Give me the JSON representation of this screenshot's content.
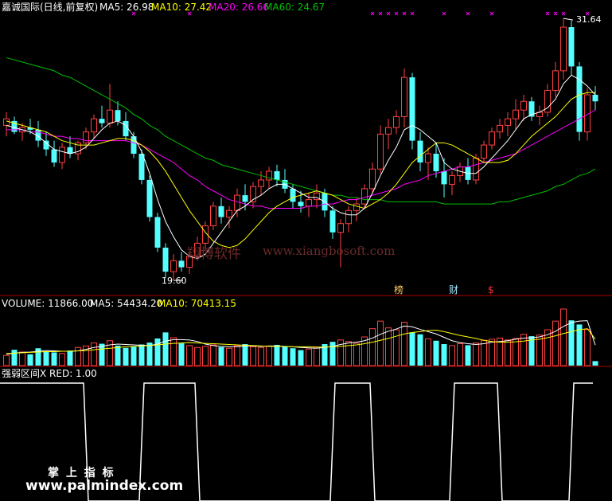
{
  "header": {
    "title": "嘉诚国际(日线,前复权)",
    "ma5": "MA5: 26.98",
    "ma10": "MA10: 27.42",
    "ma20": "MA20: 26.66",
    "ma60": "MA60: 24.67"
  },
  "volume_header": {
    "volume": "VOLUME: 11866.00",
    "ma5": "MA5: 54434.20",
    "ma10": "MA10: 70413.15"
  },
  "indicator_header": "强弱区间X RED: 1.00",
  "watermark": {
    "cn": "翔博软件",
    "url": "www.xiangbosoft.com"
  },
  "footer": {
    "cn": "掌 上 指 标",
    "url": "www.palmindex.com"
  },
  "markers": {
    "m1": "榜",
    "m2": "财",
    "m3": "$"
  },
  "colors": {
    "up": "#ff4040",
    "down": "#54ffff",
    "ma5": "#ffffff",
    "ma10": "#ffff00",
    "ma20": "#ff00ff",
    "ma60": "#00c000",
    "indicator": "#ffffff",
    "separator": "#b00000"
  },
  "chart_data": [
    {
      "type": "candlestick",
      "high_label": "31.64",
      "low_label": "19.60",
      "ohlc": [
        [
          26.7,
          27.3,
          26.2,
          27.0
        ],
        [
          26.9,
          27.1,
          26.3,
          26.4
        ],
        [
          26.4,
          26.8,
          26.0,
          26.6
        ],
        [
          26.6,
          27.0,
          26.3,
          26.5
        ],
        [
          26.5,
          26.9,
          25.7,
          26.0
        ],
        [
          26.0,
          26.4,
          25.3,
          25.6
        ],
        [
          25.6,
          26.0,
          24.8,
          25.0
        ],
        [
          25.0,
          25.9,
          24.7,
          25.7
        ],
        [
          25.7,
          26.2,
          25.2,
          25.4
        ],
        [
          25.4,
          26.0,
          25.1,
          25.9
        ],
        [
          25.9,
          26.6,
          25.6,
          26.4
        ],
        [
          26.4,
          27.2,
          26.1,
          27.0
        ],
        [
          27.0,
          27.6,
          26.6,
          26.8
        ],
        [
          26.8,
          28.6,
          26.6,
          27.4
        ],
        [
          27.4,
          27.8,
          26.7,
          26.9
        ],
        [
          26.9,
          27.3,
          26.0,
          26.2
        ],
        [
          26.2,
          26.4,
          25.2,
          25.4
        ],
        [
          25.4,
          25.6,
          24.0,
          24.2
        ],
        [
          24.2,
          24.4,
          22.3,
          22.5
        ],
        [
          22.5,
          22.7,
          20.9,
          21.1
        ],
        [
          21.1,
          21.3,
          19.7,
          20.0
        ],
        [
          20.0,
          20.8,
          19.6,
          20.5
        ],
        [
          20.5,
          20.9,
          20.0,
          20.2
        ],
        [
          20.2,
          20.9,
          19.9,
          20.7
        ],
        [
          20.7,
          21.6,
          20.5,
          21.3
        ],
        [
          21.3,
          22.3,
          21.0,
          22.1
        ],
        [
          22.1,
          23.2,
          21.9,
          23.0
        ],
        [
          23.0,
          23.4,
          22.2,
          22.5
        ],
        [
          22.5,
          23.0,
          22.0,
          22.8
        ],
        [
          22.8,
          23.8,
          22.5,
          23.5
        ],
        [
          23.5,
          24.0,
          22.8,
          23.2
        ],
        [
          23.2,
          24.1,
          22.9,
          23.9
        ],
        [
          23.9,
          24.6,
          23.5,
          24.2
        ],
        [
          24.2,
          24.8,
          23.8,
          24.6
        ],
        [
          24.6,
          24.9,
          23.9,
          24.2
        ],
        [
          24.2,
          24.7,
          23.6,
          23.8
        ],
        [
          23.8,
          24.0,
          22.9,
          23.2
        ],
        [
          23.2,
          23.7,
          22.7,
          23.0
        ],
        [
          23.0,
          23.6,
          22.5,
          23.3
        ],
        [
          23.3,
          24.0,
          22.9,
          23.6
        ],
        [
          23.6,
          23.8,
          22.5,
          22.8
        ],
        [
          22.8,
          23.0,
          21.5,
          21.8
        ],
        [
          21.8,
          22.4,
          20.2,
          22.2
        ],
        [
          22.2,
          23.0,
          21.8,
          22.8
        ],
        [
          22.8,
          23.4,
          22.3,
          23.1
        ],
        [
          23.1,
          24.0,
          22.9,
          23.8
        ],
        [
          23.8,
          25.0,
          23.6,
          24.7
        ],
        [
          24.7,
          26.7,
          24.5,
          26.3
        ],
        [
          26.3,
          27.0,
          25.6,
          26.6
        ],
        [
          26.6,
          27.4,
          26.3,
          27.1
        ],
        [
          27.1,
          29.3,
          26.6,
          28.9
        ],
        [
          28.9,
          29.1,
          25.6,
          26.0
        ],
        [
          26.0,
          26.4,
          24.6,
          25.0
        ],
        [
          25.0,
          25.7,
          24.2,
          25.4
        ],
        [
          25.4,
          25.9,
          24.3,
          24.6
        ],
        [
          24.6,
          25.2,
          23.4,
          24.0
        ],
        [
          24.0,
          24.6,
          23.5,
          24.4
        ],
        [
          24.4,
          25.0,
          24.1,
          24.8
        ],
        [
          24.8,
          25.2,
          24.0,
          24.2
        ],
        [
          24.2,
          25.4,
          24.0,
          25.2
        ],
        [
          25.2,
          26.0,
          25.0,
          25.8
        ],
        [
          25.8,
          26.6,
          25.6,
          26.4
        ],
        [
          26.4,
          27.0,
          26.1,
          26.7
        ],
        [
          26.7,
          27.3,
          26.2,
          27.0
        ],
        [
          27.0,
          27.9,
          26.5,
          27.4
        ],
        [
          27.4,
          28.1,
          26.9,
          27.8
        ],
        [
          27.8,
          28.0,
          26.9,
          27.1
        ],
        [
          27.1,
          27.6,
          26.7,
          27.3
        ],
        [
          27.3,
          28.6,
          27.1,
          28.3
        ],
        [
          28.3,
          29.6,
          28.0,
          29.2
        ],
        [
          29.2,
          31.6,
          28.8,
          31.2
        ],
        [
          31.2,
          31.5,
          29.0,
          29.4
        ],
        [
          29.4,
          29.6,
          26.0,
          26.4
        ],
        [
          26.4,
          28.4,
          26.0,
          28.1
        ],
        [
          28.1,
          28.5,
          27.4,
          27.8
        ]
      ],
      "ma5": [
        26.7,
        26.6,
        26.5,
        26.4,
        26.2,
        25.9,
        25.6,
        25.5,
        25.4,
        25.5,
        25.7,
        26.1,
        26.5,
        26.8,
        26.9,
        26.7,
        26.2,
        25.5,
        24.5,
        23.3,
        22.3,
        21.6,
        21.0,
        20.7,
        20.6,
        20.8,
        21.3,
        21.8,
        22.3,
        22.8,
        23.0,
        23.3,
        23.5,
        23.8,
        24.0,
        24.0,
        23.8,
        23.6,
        23.4,
        23.4,
        23.2,
        22.9,
        22.7,
        22.6,
        22.6,
        22.9,
        23.6,
        24.4,
        25.1,
        25.7,
        26.5,
        26.7,
        26.5,
        26.2,
        25.9,
        25.0,
        24.7,
        24.6,
        24.5,
        24.5,
        24.8,
        25.2,
        25.6,
        26.0,
        26.5,
        27.0,
        27.2,
        27.3,
        27.5,
        27.9,
        28.6,
        29.0,
        28.8,
        28.5,
        28.1
      ],
      "ma10": [
        26.9,
        26.8,
        26.7,
        26.6,
        26.5,
        26.4,
        26.2,
        26.0,
        25.9,
        25.8,
        25.8,
        25.8,
        25.9,
        26.0,
        26.1,
        26.1,
        26.0,
        25.8,
        25.5,
        25.1,
        24.6,
        24.0,
        23.4,
        22.8,
        22.3,
        21.8,
        21.4,
        21.2,
        21.1,
        21.2,
        21.5,
        21.9,
        22.3,
        22.7,
        23.0,
        23.2,
        23.4,
        23.5,
        23.6,
        23.7,
        23.6,
        23.5,
        23.3,
        23.1,
        23.0,
        22.9,
        23.1,
        23.3,
        23.6,
        24.0,
        24.5,
        25.0,
        25.3,
        25.6,
        25.9,
        25.9,
        25.8,
        25.6,
        25.4,
        25.2,
        25.0,
        25.0,
        25.0,
        25.1,
        25.4,
        25.8,
        26.2,
        26.5,
        26.8,
        27.1,
        27.5,
        27.9,
        28.1,
        28.2,
        28.2
      ],
      "ma20": [
        26.5,
        26.5,
        26.5,
        26.4,
        26.4,
        26.3,
        26.2,
        26.2,
        26.1,
        26.1,
        26.0,
        26.0,
        26.0,
        26.0,
        26.0,
        26.0,
        25.9,
        25.8,
        25.6,
        25.4,
        25.2,
        25.0,
        24.7,
        24.4,
        24.2,
        23.9,
        23.7,
        23.5,
        23.3,
        23.2,
        23.1,
        23.0,
        23.0,
        22.9,
        22.9,
        22.9,
        22.9,
        22.9,
        23.0,
        23.0,
        23.1,
        23.1,
        23.2,
        23.3,
        23.3,
        23.4,
        23.5,
        23.6,
        23.7,
        23.8,
        24.0,
        24.1,
        24.2,
        24.4,
        24.5,
        24.6,
        24.7,
        24.8,
        24.8,
        24.9,
        25.0,
        25.1,
        25.2,
        25.3,
        25.4,
        25.6,
        25.8,
        26.0,
        26.2,
        26.4,
        26.6,
        26.8,
        27.0,
        27.2,
        27.4
      ],
      "ma60": [
        29.8,
        29.7,
        29.6,
        29.5,
        29.4,
        29.3,
        29.2,
        29.0,
        28.9,
        28.7,
        28.5,
        28.3,
        28.1,
        27.9,
        27.7,
        27.5,
        27.2,
        27.0,
        26.7,
        26.5,
        26.2,
        26.0,
        25.8,
        25.6,
        25.4,
        25.2,
        25.1,
        24.9,
        24.8,
        24.7,
        24.6,
        24.5,
        24.4,
        24.3,
        24.2,
        24.1,
        24.0,
        23.9,
        23.8,
        23.7,
        23.6,
        23.5,
        23.5,
        23.4,
        23.4,
        23.3,
        23.3,
        23.3,
        23.2,
        23.2,
        23.2,
        23.2,
        23.2,
        23.2,
        23.2,
        23.1,
        23.1,
        23.1,
        23.1,
        23.1,
        23.1,
        23.1,
        23.2,
        23.2,
        23.3,
        23.4,
        23.5,
        23.6,
        23.7,
        23.9,
        24.0,
        24.2,
        24.4,
        24.5,
        24.7
      ]
    },
    {
      "type": "bar",
      "volume": [
        27000,
        42000,
        36000,
        30000,
        46000,
        38000,
        35000,
        32000,
        40000,
        48000,
        52000,
        60000,
        58000,
        66000,
        53000,
        47000,
        50000,
        56000,
        61000,
        72000,
        88000,
        74000,
        59000,
        53000,
        48000,
        51000,
        55000,
        49000,
        46000,
        53000,
        57000,
        50000,
        48000,
        52000,
        55000,
        50000,
        46000,
        41000,
        44000,
        49000,
        57000,
        63000,
        68000,
        64000,
        59000,
        76000,
        98000,
        118000,
        100000,
        95000,
        115000,
        88000,
        83000,
        71000,
        66000,
        57000,
        53000,
        58000,
        54000,
        60000,
        67000,
        70000,
        73000,
        68000,
        72000,
        83000,
        78000,
        81000,
        95000,
        118000,
        150000,
        120000,
        109000,
        96000,
        11866
      ],
      "ma5": [
        30000,
        33000,
        35000,
        36000,
        38000,
        40000,
        39000,
        38000,
        38000,
        39000,
        43000,
        48000,
        51000,
        55000,
        57000,
        56000,
        55000,
        54000,
        53000,
        57000,
        65000,
        69000,
        69000,
        68000,
        64000,
        57000,
        53000,
        51000,
        50000,
        50000,
        52000,
        52000,
        51000,
        52000,
        52000,
        51000,
        50000,
        48000,
        47000,
        46000,
        48000,
        51000,
        56000,
        60000,
        62000,
        66000,
        73000,
        83000,
        91000,
        97000,
        105000,
        103000,
        96000,
        90000,
        84000,
        75000,
        66000,
        61000,
        58000,
        56000,
        58000,
        62000,
        64000,
        66000,
        70000,
        73000,
        74000,
        76000,
        82000,
        91000,
        104000,
        114000,
        118000,
        119000,
        54434
      ],
      "ma10": [
        32000,
        33000,
        34000,
        35000,
        36000,
        37000,
        37000,
        38000,
        38000,
        39000,
        40000,
        42000,
        44000,
        46000,
        48000,
        50000,
        51000,
        52000,
        53000,
        55000,
        57000,
        59000,
        60000,
        61000,
        60000,
        59000,
        58000,
        57000,
        56000,
        55000,
        54000,
        53000,
        52000,
        51000,
        51000,
        51000,
        50000,
        50000,
        50000,
        49000,
        49000,
        50000,
        51000,
        53000,
        55000,
        58000,
        62000,
        67000,
        72000,
        78000,
        84000,
        88000,
        90000,
        93000,
        94000,
        90000,
        85000,
        80000,
        76000,
        72000,
        67000,
        64000,
        62000,
        62000,
        63000,
        65000,
        68000,
        70000,
        74000,
        79000,
        85000,
        90000,
        95000,
        98000,
        70413
      ]
    },
    {
      "type": "line",
      "name": "RED",
      "value": 1.0,
      "segments": [
        [
          0,
          10,
          1
        ],
        [
          10,
          17,
          0
        ],
        [
          17,
          24,
          1
        ],
        [
          24,
          41,
          0
        ],
        [
          41,
          46,
          1
        ],
        [
          46,
          56,
          0
        ],
        [
          56,
          62,
          1
        ],
        [
          62,
          71,
          0
        ],
        [
          71,
          74,
          1
        ]
      ],
      "ylim": [
        0,
        1
      ]
    }
  ]
}
